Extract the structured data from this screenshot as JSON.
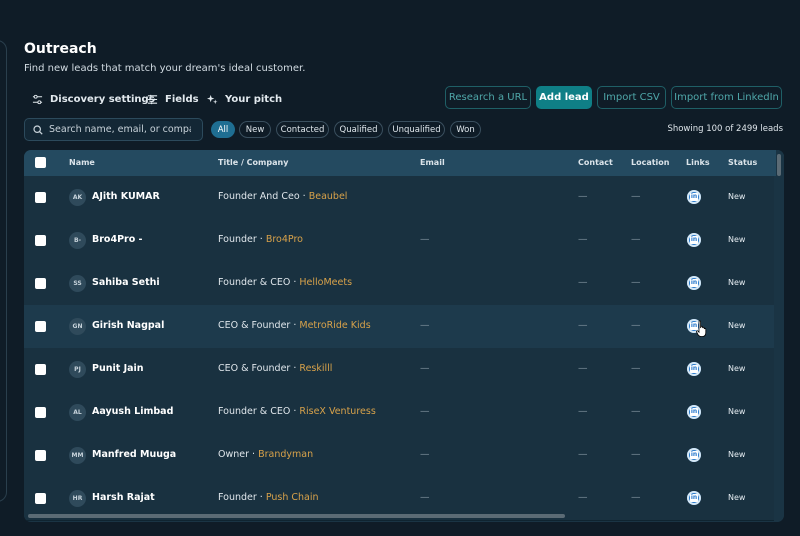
{
  "page": {
    "title": "Outreach",
    "subtitle": "Find new leads that match your dream's ideal customer."
  },
  "toolbar": {
    "discovery_settings": "Discovery settings",
    "fields": "Fields",
    "your_pitch": "Your pitch",
    "research_url": "Research a URL",
    "add_lead": "Add lead",
    "import_csv": "Import CSV",
    "import_linkedin": "Import from LinkedIn"
  },
  "search": {
    "placeholder": "Search name, email, or company"
  },
  "filters": {
    "all": "All",
    "new": "New",
    "contacted": "Contacted",
    "qualified": "Qualified",
    "unqualified": "Unqualified",
    "won": "Won"
  },
  "showing": "Showing 100 of 2499 leads",
  "table": {
    "headers": {
      "name": "Name",
      "title_company": "Title / Company",
      "email": "Email",
      "contact": "Contact",
      "location": "Location",
      "links": "Links",
      "status": "Status"
    },
    "dash": "—",
    "rows": [
      {
        "initials": "AK",
        "name": "AJith KUMAR",
        "title": "Founder And Ceo",
        "company": "Beaubel",
        "status": "New"
      },
      {
        "initials": "B-",
        "name": "Bro4Pro -",
        "title": "Founder",
        "company": "Bro4Pro",
        "status": "New"
      },
      {
        "initials": "SS",
        "name": "Sahiba Sethi",
        "title": "Founder & CEO",
        "company": "HelloMeets",
        "status": "New"
      },
      {
        "initials": "GN",
        "name": "Girish Nagpal",
        "title": "CEO & Founder",
        "company": "MetroRide Kids",
        "status": "New"
      },
      {
        "initials": "PJ",
        "name": "Punit Jain",
        "title": "CEO & Founder",
        "company": "Reskilll",
        "status": "New"
      },
      {
        "initials": "AL",
        "name": "Aayush Limbad",
        "title": "Founder & CEO",
        "company": "RiseX Venturess",
        "status": "New"
      },
      {
        "initials": "MM",
        "name": "Manfred Muuga",
        "title": "Owner",
        "company": "Brandyman",
        "status": "New"
      },
      {
        "initials": "HR",
        "name": "Harsh Rajat",
        "title": "Founder",
        "company": "Push Chain",
        "status": "New"
      }
    ]
  },
  "colors": {
    "background": "#0f1c27",
    "accent": "#0f7f86",
    "company_text": "#d8a24a",
    "linkedin": "#1f73c9",
    "active_chip": "#1f6e92"
  }
}
